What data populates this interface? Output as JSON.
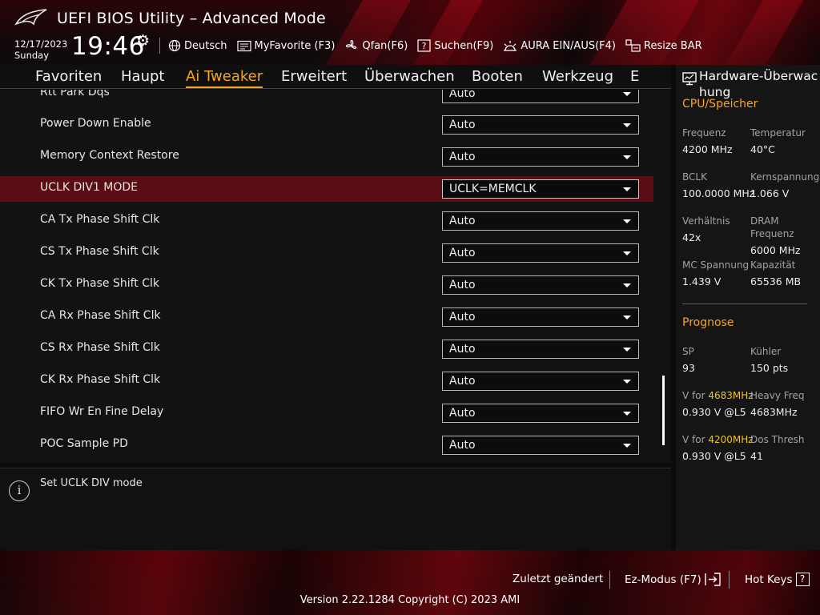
{
  "header": {
    "app_title": "UEFI BIOS Utility – Advanced Mode",
    "date": "12/17/2023",
    "day": "Sunday",
    "time": "19:46",
    "toolbar": [
      {
        "label": "Deutsch",
        "icon": "globe-icon"
      },
      {
        "label": "MyFavorite (F3)",
        "icon": "favorite-icon"
      },
      {
        "label": "Qfan(F6)",
        "icon": "fan-icon"
      },
      {
        "label": "Suchen(F9)",
        "icon": "search-help-icon"
      },
      {
        "label": "AURA EIN/AUS(F4)",
        "icon": "aura-icon"
      },
      {
        "label": "Resize BAR",
        "icon": "resize-bar-icon"
      }
    ]
  },
  "nav": {
    "tabs": [
      "Favoriten",
      "Haupt",
      "Ai Tweaker",
      "Erweitert",
      "Überwachen",
      "Booten",
      "Werkzeug",
      "E"
    ],
    "active": "Ai Tweaker"
  },
  "settings": [
    {
      "label": "Rtt Park Dqs",
      "value": "Auto"
    },
    {
      "label": "Power Down Enable",
      "value": "Auto"
    },
    {
      "label": "Memory Context Restore",
      "value": "Auto"
    },
    {
      "label": "UCLK DIV1 MODE",
      "value": "UCLK=MEMCLK",
      "selected": true
    },
    {
      "label": "CA Tx Phase Shift Clk",
      "value": "Auto"
    },
    {
      "label": "CS Tx Phase Shift Clk",
      "value": "Auto"
    },
    {
      "label": "CK Tx Phase Shift Clk",
      "value": "Auto"
    },
    {
      "label": "CA Rx Phase Shift Clk",
      "value": "Auto"
    },
    {
      "label": "CS Rx Phase Shift Clk",
      "value": "Auto"
    },
    {
      "label": "CK Rx Phase Shift Clk",
      "value": "Auto"
    },
    {
      "label": "FIFO Wr En Fine Delay",
      "value": "Auto"
    },
    {
      "label": "POC Sample PD",
      "value": "Auto"
    }
  ],
  "help": {
    "text": "Set UCLK DIV mode",
    "icon": "info-icon"
  },
  "hw_monitor": {
    "title": "Hardware-Überwachung",
    "title_line1": "Hardware-Überwac",
    "title_line2": "hung",
    "cpu_section": "CPU/Speicher",
    "freq_label": "Frequenz",
    "freq_value": "4200 MHz",
    "temp_label": "Temperatur",
    "temp_value": "40°C",
    "bclk_label": "BCLK",
    "bclk_value": "100.0000 MHz",
    "core_volt_label": "Kernspannung",
    "core_volt_value": "1.066 V",
    "ratio_label": "Verhältnis",
    "ratio_value": "42x",
    "dram_label_1": "DRAM",
    "dram_label_2": "Frequenz",
    "dram_value": "6000 MHz",
    "mc_label": "MC Spannung",
    "mc_value": "1.439 V",
    "cap_label": "Kapazität",
    "cap_value": "65536 MB",
    "prognose_section": "Prognose",
    "sp_label": "SP",
    "sp_value": "93",
    "cooler_label": "Kühler",
    "cooler_value": "150 pts",
    "vfor1_prefix": "V for ",
    "vfor1_freq": "4683MHz",
    "vfor1_value": "0.930 V @L5",
    "heavy_label": "Heavy Freq",
    "heavy_value": "4683MHz",
    "vfor2_prefix": "V for ",
    "vfor2_freq": "4200MHz",
    "vfor2_value": "0.930 V @L5",
    "dos_label": "Dos Thresh",
    "dos_value": "41",
    "highlight_color": "#f0c419"
  },
  "footer": {
    "last_modified": "Zuletzt geändert",
    "ez_mode": "Ez-Modus (F7)",
    "hot_keys": "Hot Keys",
    "hot_keys_icon_glyph": "?",
    "version": "Version 2.22.1284 Copyright (C) 2023 AMI"
  },
  "colors": {
    "accent": "#f5a623",
    "selected_row": "#5a0d12",
    "brand_red": "#b0101c"
  }
}
